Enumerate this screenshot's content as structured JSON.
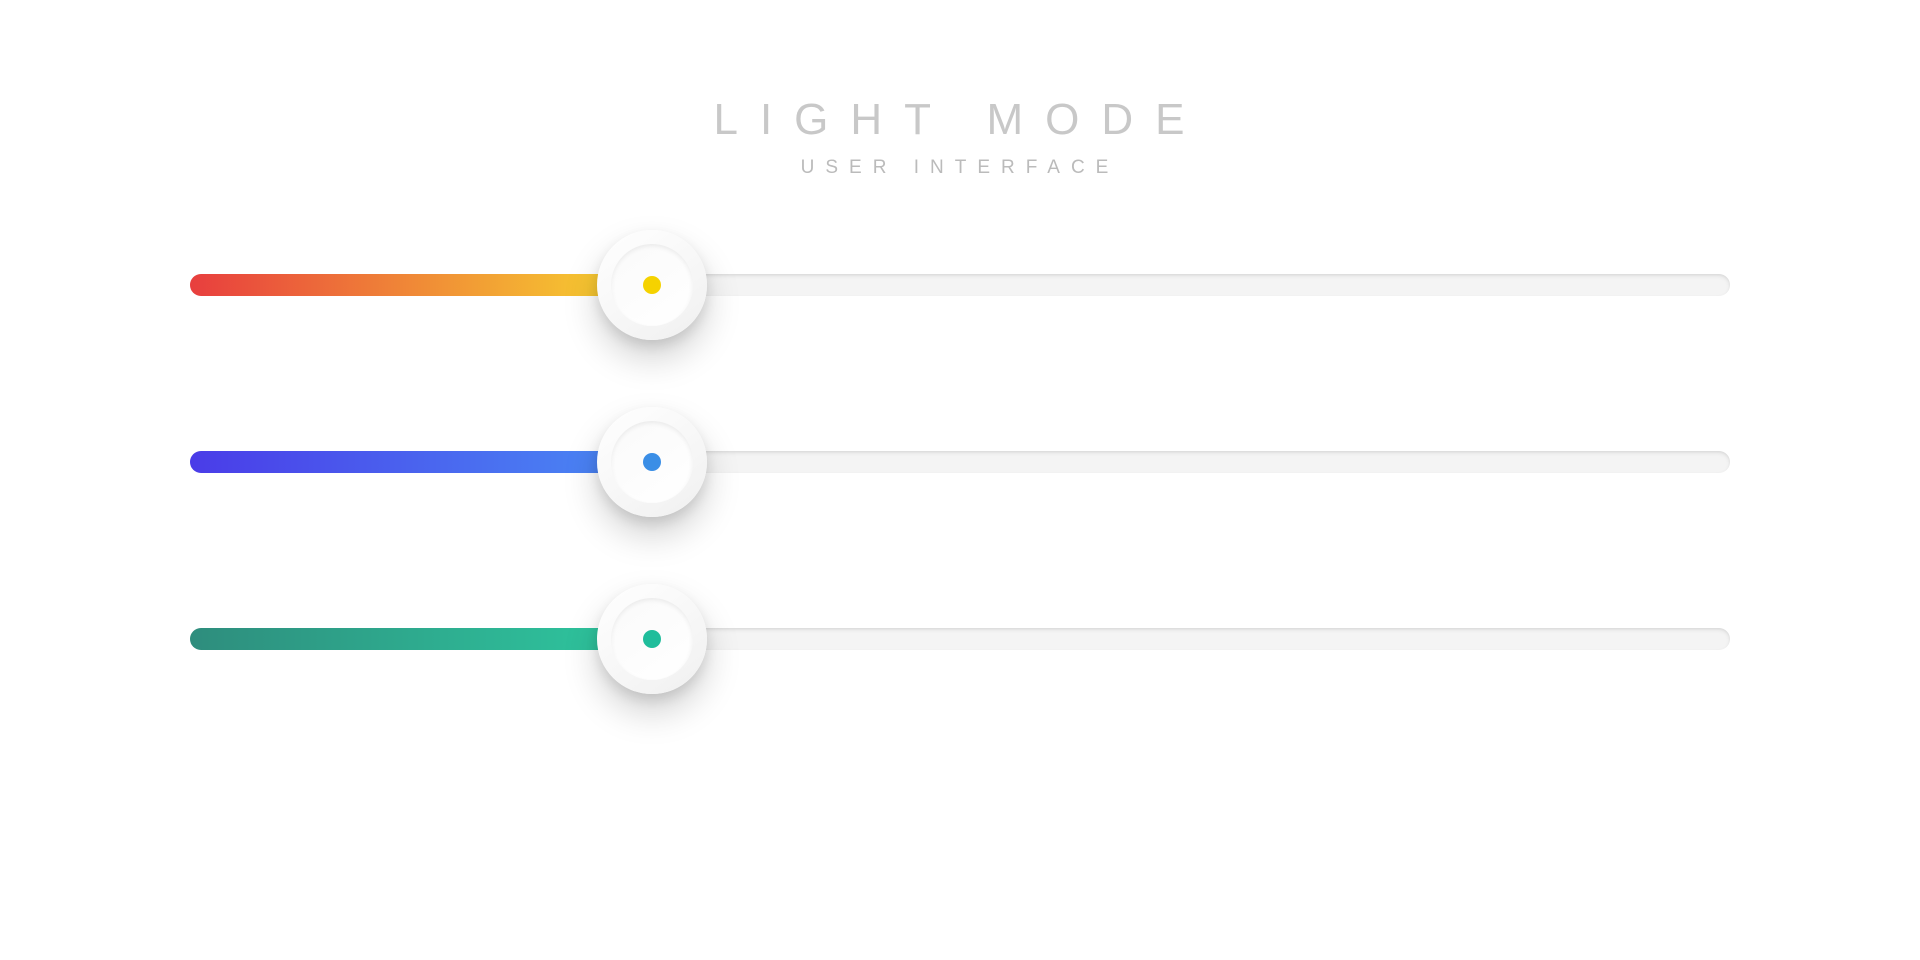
{
  "heading": {
    "title": "LIGHT MODE",
    "subtitle": "USER INTERFACE"
  },
  "sliders": [
    {
      "id": "warm",
      "value_percent": 30,
      "fill_gradient_start": "#e83e3e",
      "fill_gradient_end": "#f8d92f",
      "dot_color": "#f5d200"
    },
    {
      "id": "blue",
      "value_percent": 30,
      "fill_gradient_start": "#4a3ce8",
      "fill_gradient_end": "#4a8cf5",
      "dot_color": "#3a8ee6"
    },
    {
      "id": "teal",
      "value_percent": 30,
      "fill_gradient_start": "#2e8d7d",
      "fill_gradient_end": "#2ec9a0",
      "dot_color": "#1fbd9b"
    }
  ]
}
